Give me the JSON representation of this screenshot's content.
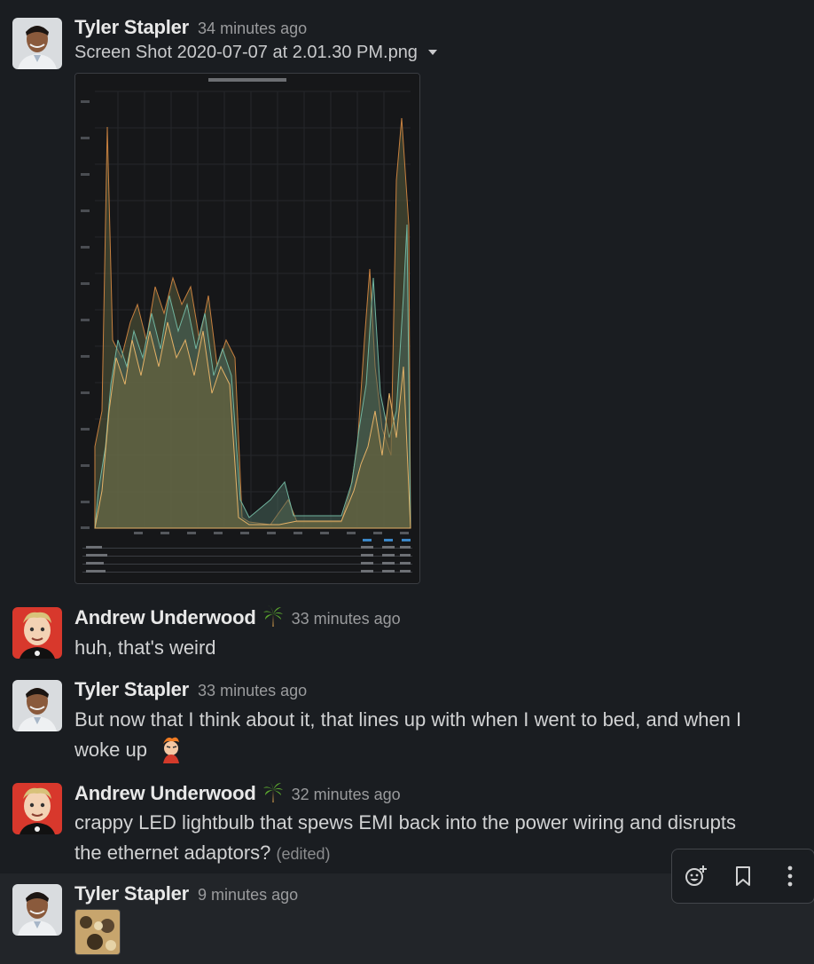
{
  "messages": [
    {
      "author": "Tyler Stapler",
      "time": "34 minutes ago",
      "file_name": "Screen Shot 2020-07-07 at 2.01.30 PM.png"
    },
    {
      "author": "Andrew Underwood",
      "time": "33 minutes ago",
      "text": "huh, that's weird"
    },
    {
      "author": "Tyler Stapler",
      "time": "33 minutes ago",
      "text_line1": "But now that I think about it, that lines up with when I went to bed, and when I",
      "text_line2": "woke up"
    },
    {
      "author": "Andrew Underwood",
      "time": "32 minutes ago",
      "text_line1": "crappy LED lightbulb that spews EMI back into the power wiring and disrupts",
      "text_line2": "the ethernet adaptors?",
      "edited": "(edited)"
    },
    {
      "author": "Tyler Stapler",
      "time": "9 minutes ago"
    }
  ],
  "icons": {
    "status": "palm-tree-icon",
    "message_emoji": "fry-squint-emoji-icon",
    "file_menu": "chevron-down-icon",
    "toolbar": [
      "add-reaction-icon",
      "bookmark-icon",
      "more-vertical-icon"
    ]
  },
  "colors": {
    "background": "#1a1d21",
    "hover_background": "#222529",
    "text": "#d1d2d3",
    "muted": "#9a9b9d"
  }
}
